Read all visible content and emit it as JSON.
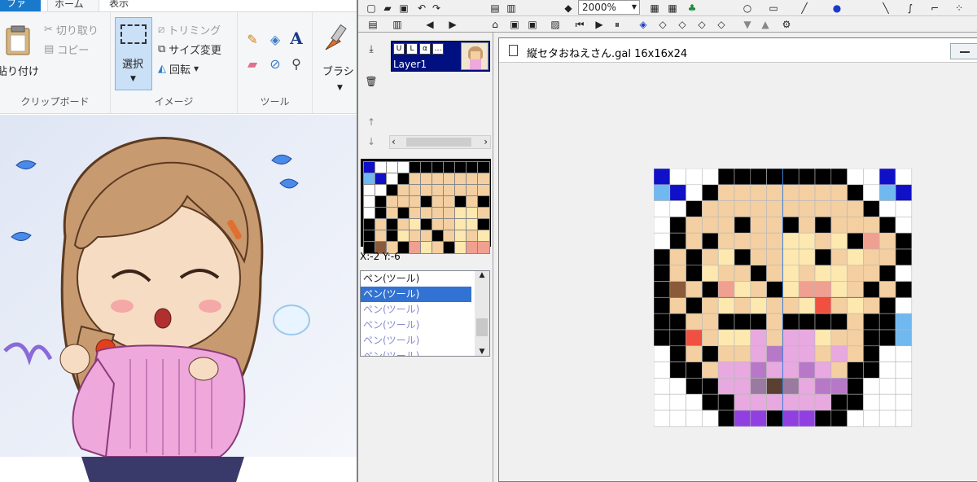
{
  "paint": {
    "tabs": {
      "file": "ファイル",
      "home": "ホーム",
      "view": "表示"
    },
    "clipboard": {
      "paste": "貼り付け",
      "cut": "切り取り",
      "copy": "コピー",
      "group": "クリップボード"
    },
    "image": {
      "select": "選択",
      "crop": "トリミング",
      "resize": "サイズ変更",
      "rotate": "回転",
      "group": "イメージ"
    },
    "tools": {
      "group": "ツール"
    },
    "brush": {
      "label": "ブラシ"
    },
    "colors": {
      "skin": "#f2d2b0",
      "hair": "#c89a70",
      "hair_dark": "#8a5a38",
      "sweater": "#eea8dc",
      "sweater_dark": "#c87ab8",
      "blush": "#f5a8a8",
      "bow": "#e04020",
      "drop": "#4a8ae8"
    }
  },
  "editor": {
    "zoom": "2000%",
    "layer": {
      "name": "Layer1",
      "toggles": [
        "U",
        "L",
        "α",
        "…"
      ]
    },
    "coords": "X:-2 Y:-6",
    "history": [
      {
        "label": "ペン(ツール)",
        "state": "normal"
      },
      {
        "label": "ペン(ツール)",
        "state": "selected"
      },
      {
        "label": "ペン(ツール)",
        "state": "gray"
      },
      {
        "label": "ペン(ツール)",
        "state": "gray"
      },
      {
        "label": "ペン(ツール)",
        "state": "gray"
      },
      {
        "label": "ペン(ツール)",
        "state": "gray"
      }
    ],
    "doc_title": "縦セタおねえさん.gal 16x16x24"
  },
  "pixel_palette": {
    "W": "#ffffff",
    "K": "#000000",
    "N": "#1010c8",
    "L": "#70b8f0",
    "A": "#f3cfa1",
    "B": "#8b5a3a",
    "D": "#5a4030",
    "Y": "#fde8b0",
    "P": "#f0a090",
    "R": "#f05040",
    "M": "#e8a8e0",
    "V": "#b878c8",
    "U": "#9040e0",
    "G": "#9a7aa0"
  },
  "pixels": [
    "NWWWKKKKKKKKWWNW",
    "LNWKAAAAAAAAKWLN",
    "WWKAAAAAAAAAAKWW",
    "WKAAAKAAKAKAAAKW",
    "WKAKAAAAYYAYKPAK",
    "KAKAYKAAYYKAYAAK",
    "KAKYAAKAYAYYAAKW",
    "KBAKPYAKYPPYAKAK",
    "KAKAYAYAAYRAYAKW",
    "KKAAKKKAKKKKAKKL",
    "KKRAYYMAMMYAAKKL",
    "WKAKAAMVMMAMAKWW",
    "WKKAMMVMMVMAKKWW",
    "WWKKMMGDGMVVKWWW",
    "WWWKKMMMMMMKKWWW",
    "WWWWKUUKUUKKWWWW"
  ]
}
